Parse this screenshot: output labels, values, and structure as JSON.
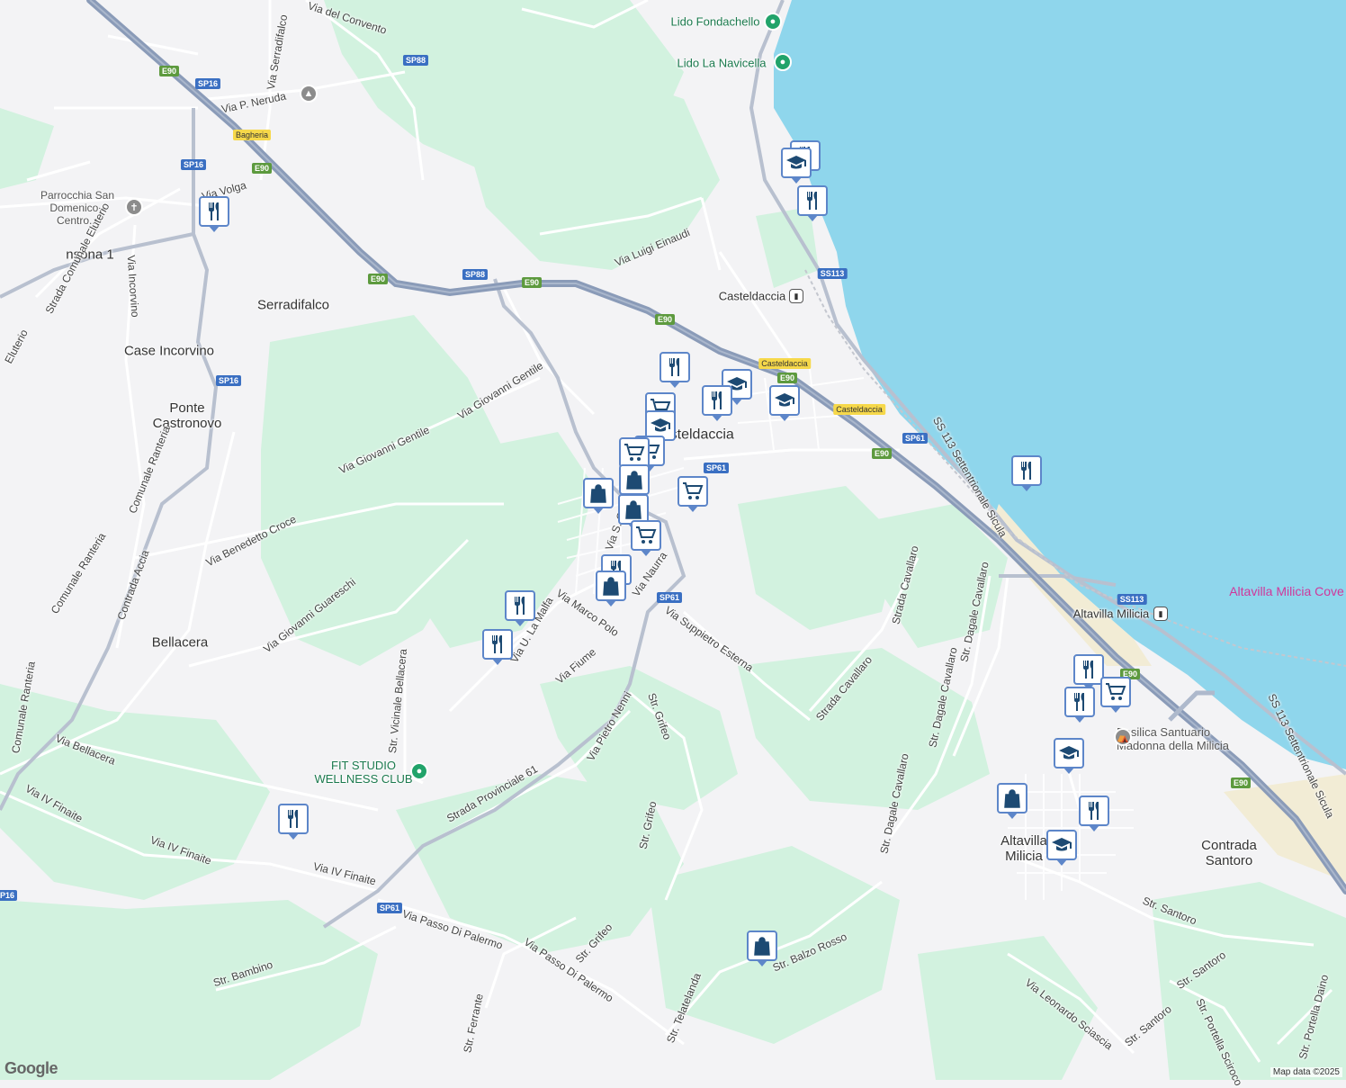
{
  "map": {
    "attribution": "Map data ©2025",
    "logo": "Google",
    "colors": {
      "sea": "#8fd6ec",
      "green": "#d2f2df",
      "land": "#f3f3f5",
      "road": "#ffffff",
      "motorway": "#8a9bb8",
      "pin_border": "#5d86c9",
      "pin_icon": "#1d4a73"
    },
    "places": {
      "lido_fondachello": "Lido Fondachello",
      "lido_la_navicella": "Lido La Navicella",
      "parrocchia": "Parrocchia San Domenico - Centro...",
      "fit_studio": "FIT STUDIO WELLNESS CLUB",
      "basilica": "Basilica Santuario Madonna della Milicia",
      "casteldaccia_station": "Casteldaccia",
      "altavilla_station": "Altavilla Milicia",
      "altavilla_cove": "Altavilla Milicia Cove",
      "serradifalco": "Serradifalco",
      "case_incorvino": "Case Incorvino",
      "ponte_castronovo": "Ponte Castronovo",
      "bellacera": "Bellacera",
      "casteldaccia_town": "Casteldaccia",
      "altavilla_town": "Altavilla Milicia",
      "contrada_santoro": "Contrada Santoro",
      "onsona": "nsona 1"
    },
    "shields": {
      "sp88_a": "SP88",
      "sp16_a": "SP16",
      "e90_a": "E90",
      "bagheria": "Bagheria",
      "sp16_b": "SP16",
      "e90_b": "E90",
      "e90_c": "E90",
      "sp88_b": "SP88",
      "e90_d": "E90",
      "e90_e": "E90",
      "casteldaccia_a": "Casteldaccia",
      "e90_f": "E90",
      "ss113_a": "SS113",
      "casteldaccia_b": "Casteldaccia",
      "sp61_a": "SP61",
      "e90_g": "E90",
      "sp61_b": "SP61",
      "sp16_c": "SP16",
      "sp61_c": "SP61",
      "ss113_b": "SS113",
      "e90_h": "E90",
      "e90_i": "E90",
      "sp61_d": "SP61",
      "sp16_d": "P16"
    },
    "streets": {
      "via_del_convento": "Via del Convento",
      "via_serradifalco": "Via Serradifalco",
      "via_p_neruda": "Via P. Neruda",
      "via_volga": "Via Volga",
      "strada_com_eluterio": "Strada Comunale Eluterio",
      "via_incorvino": "Via Incorvino",
      "eluterio": "Eluterio",
      "via_luigi_einaudi": "Via Luigi Einaudi",
      "via_giovanni_gentile_a": "Via Giovanni Gentile",
      "via_giovanni_gentile_b": "Via Giovanni Gentile",
      "comunale_ranteria_a": "Comunale Ranteria",
      "via_benedetto_croce": "Via Benedetto Croce",
      "comunale_ranteria_b": "Comunale Ranteria",
      "contrada_accia": "Contrada Accia",
      "via_giovanni_guareschi": "Via Giovanni Guareschi",
      "comunale_ranteria_c": "Comunale Ranteria",
      "via_bellacera": "Via Bellacera",
      "via_iv_finaite_a": "Via IV Finaite",
      "via_iv_finaite_b": "Via IV Finaite",
      "via_iv_finaite_c": "Via IV Finaite",
      "str_vicinale_bellacera": "Str. Vicinale Bellacera",
      "via_u_la_malfa": "Via U. La Malfa",
      "via_marco_polo": "Via Marco Polo",
      "via_fiume": "Via Fiume",
      "via_s_g": "Via S. G",
      "via_naurra": "Via Naurra",
      "via_suppietro_esterna": "Via Suppietro Esterna",
      "strada_cavallaro_a": "Strada Cavallaro",
      "strada_cavallaro_b": "Strada Cavallaro",
      "str_dagale_cavallaro_a": "Str. Dagale Cavallaro",
      "str_dagale_cavallaro_b": "Str. Dagale Cavallaro",
      "str_dagale_cavallaro_c": "Str. Dagale Cavallaro",
      "ss113_sett_a": "SS 113 Settentrionale Sicula",
      "ss113_sett_b": "SS 113 Settentrionale Sicula",
      "str_grifeo_a": "Str. Grifeo",
      "str_grifeo_b": "Str. Grifeo",
      "str_grifeo_c": "Str. Grifeo",
      "via_pietro_nenni": "Via Pietro Nenni",
      "strada_provinciale_61": "Strada Provinciale 61",
      "via_passo_di_palermo_a": "Via Passo Di Palermo",
      "via_passo_di_palermo_b": "Via Passo Di Palermo",
      "str_bambino": "Str. Bambino",
      "str_ferrante": "Str. Ferrante",
      "str_telatelanda": "Str. Telatelanda",
      "str_balzo_rosso": "Str. Balzo Rosso",
      "str_santoro_a": "Str. Santoro",
      "str_santoro_b": "Str. Santoro",
      "str_santoro_c": "Str. Santoro",
      "via_leonardo_sciascia": "Via Leonardo Sciascia",
      "str_portella_sciroco": "Str. Portella Sciroco",
      "str_portella_daino": "Str. Portella Daino"
    },
    "pins": [
      {
        "type": "restaurant"
      },
      {
        "type": "school"
      },
      {
        "type": "restaurant"
      },
      {
        "type": "restaurant"
      },
      {
        "type": "restaurant"
      },
      {
        "type": "school"
      },
      {
        "type": "school"
      },
      {
        "type": "restaurant"
      },
      {
        "type": "grocery"
      },
      {
        "type": "school"
      },
      {
        "type": "grocery"
      },
      {
        "type": "grocery"
      },
      {
        "type": "shopping"
      },
      {
        "type": "shopping"
      },
      {
        "type": "grocery"
      },
      {
        "type": "shopping"
      },
      {
        "type": "grocery"
      },
      {
        "type": "restaurant"
      },
      {
        "type": "shopping"
      },
      {
        "type": "restaurant"
      },
      {
        "type": "restaurant"
      },
      {
        "type": "restaurant"
      },
      {
        "type": "restaurant"
      },
      {
        "type": "restaurant"
      },
      {
        "type": "grocery"
      },
      {
        "type": "school"
      },
      {
        "type": "shopping"
      },
      {
        "type": "restaurant"
      },
      {
        "type": "school"
      },
      {
        "type": "shopping"
      }
    ]
  }
}
